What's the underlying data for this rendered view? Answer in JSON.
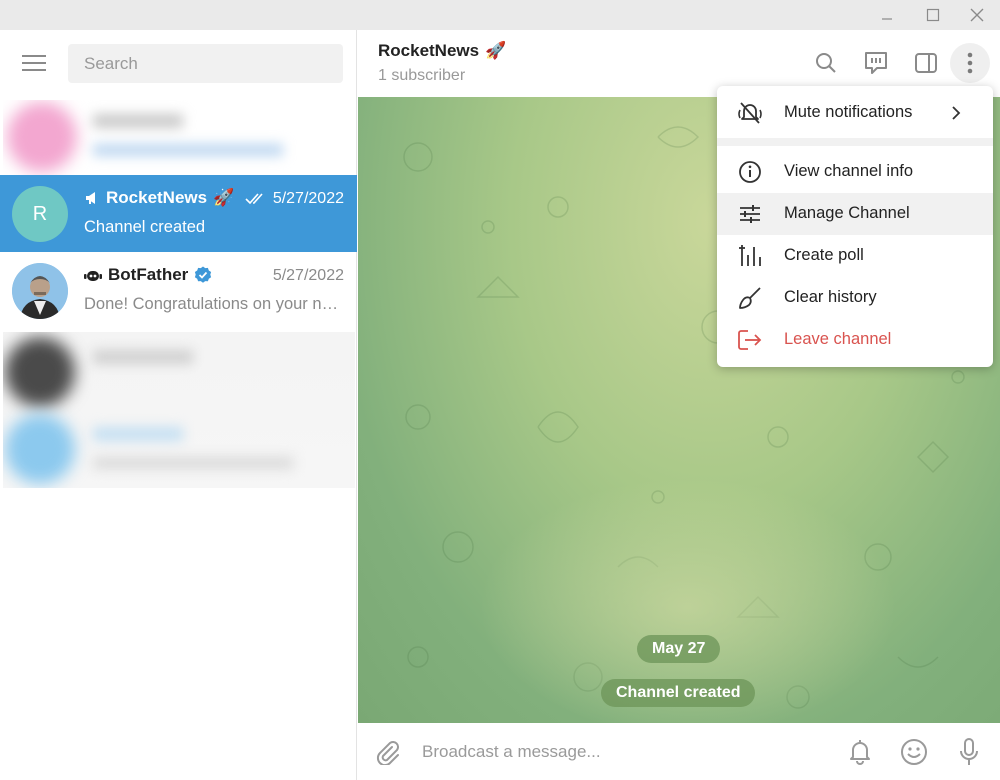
{
  "window": {
    "controls": [
      "minimize",
      "maximize",
      "close"
    ]
  },
  "sidebar": {
    "search_placeholder": "Search",
    "chats": [
      {
        "name": "RocketNews",
        "name_emoji": "🚀",
        "date": "5/27/2022",
        "preview": "Channel created",
        "avatar_letter": "R",
        "avatar_color": "#6fc8c4",
        "active": true,
        "type_icon": "megaphone-icon",
        "status_icon": "double-check-icon"
      },
      {
        "name": "BotFather",
        "date": "5/27/2022",
        "preview": "Done! Congratulations on your new bot. You will find it at",
        "active": false,
        "type_icon": "bot-icon",
        "verified_icon": "verified-badge-icon"
      }
    ]
  },
  "header": {
    "title": "RocketNews",
    "title_emoji": "🚀",
    "subtitle": "1 subscriber"
  },
  "chat": {
    "date_pill": "May 27",
    "service_message": "Channel created"
  },
  "composer": {
    "placeholder": "Broadcast a message..."
  },
  "menu": {
    "items": [
      {
        "label": "Mute notifications",
        "icon": "mute-bell-icon",
        "has_submenu": true
      },
      {
        "label": "View channel info",
        "icon": "info-icon"
      },
      {
        "label": "Manage Channel",
        "icon": "sliders-icon",
        "hovered": true
      },
      {
        "label": "Create poll",
        "icon": "poll-icon"
      },
      {
        "label": "Clear history",
        "icon": "broom-icon"
      },
      {
        "label": "Leave channel",
        "icon": "leave-icon",
        "danger": true
      }
    ]
  },
  "colors": {
    "accent": "#3e98d8",
    "danger": "#d9534f",
    "verified": "#3e98d8"
  }
}
